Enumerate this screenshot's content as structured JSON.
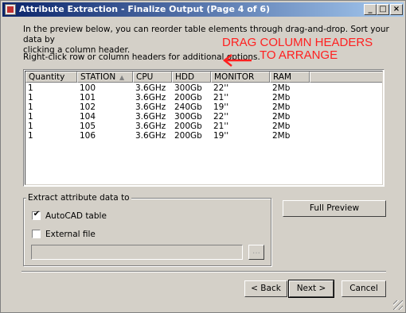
{
  "window": {
    "title": "Attribute Extraction - Finalize Output (Page 4 of 6)",
    "buttons": {
      "minimize": "_",
      "maximize": "□",
      "close": "×"
    }
  },
  "instructions": {
    "line1": "In the preview below, you can reorder table elements through drag-and-drop. Sort your data by",
    "line2": "clicking a column header.",
    "line3": "Right-click row or column headers for additional options."
  },
  "annotation": {
    "line1": "DRAG COLUMN HEADERS",
    "line2": "TO ARRANGE",
    "color": "#ff2020"
  },
  "table": {
    "sorted_column": "STATION",
    "columns": [
      "Quantity",
      "STATION",
      "CPU",
      "HDD",
      "MONITOR",
      "RAM"
    ],
    "rows": [
      [
        "1",
        "100",
        "3.6GHz",
        "300Gb",
        "22''",
        "2Mb"
      ],
      [
        "1",
        "101",
        "3.6GHz",
        "200Gb",
        "21''",
        "2Mb"
      ],
      [
        "1",
        "102",
        "3.6GHz",
        "240Gb",
        "19''",
        "2Mb"
      ],
      [
        "1",
        "104",
        "3.6GHz",
        "300Gb",
        "22''",
        "2Mb"
      ],
      [
        "1",
        "105",
        "3.6GHz",
        "200Gb",
        "21''",
        "2Mb"
      ],
      [
        "1",
        "106",
        "3.6GHz",
        "200Gb",
        "19''",
        "2Mb"
      ]
    ]
  },
  "extract": {
    "group_label": "Extract attribute data to",
    "autocad_label": "AutoCAD table",
    "autocad_checked": true,
    "external_label": "External file",
    "external_checked": false,
    "path_value": "",
    "browse_label": "..."
  },
  "buttons": {
    "full_preview": "Full Preview",
    "back": "< Back",
    "next": "Next >",
    "cancel": "Cancel"
  }
}
